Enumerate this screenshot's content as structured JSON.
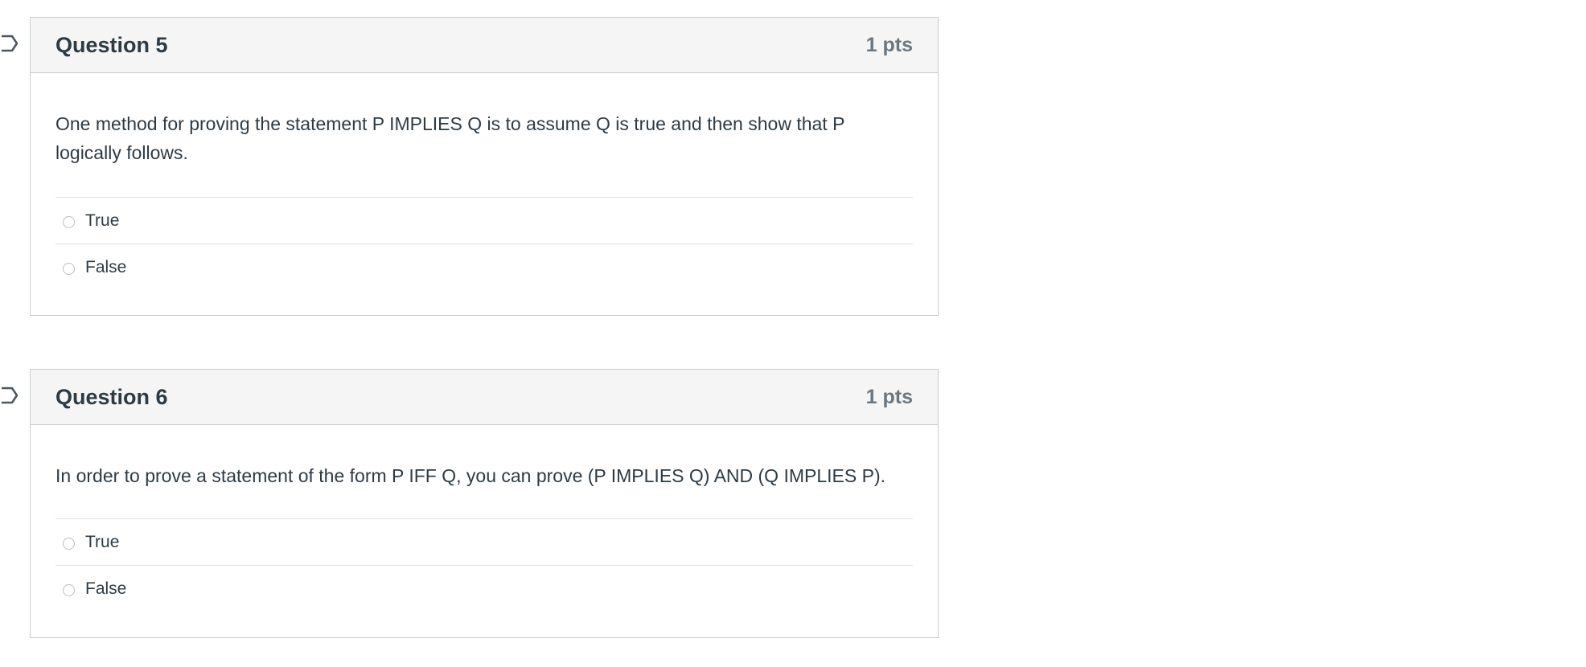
{
  "questions": [
    {
      "title": "Question 5",
      "points": "1 pts",
      "text": "One method for proving the statement P IMPLIES Q is to assume Q is true and then show that P logically follows.",
      "answers": [
        "True",
        "False"
      ]
    },
    {
      "title": "Question 6",
      "points": "1 pts",
      "text": "In order to prove a statement of the form P IFF Q, you can prove (P IMPLIES Q) AND (Q IMPLIES P).",
      "answers": [
        "True",
        "False"
      ]
    }
  ],
  "icons": {
    "flag": "flag-question-icon",
    "radio": "radio-button-icon"
  }
}
